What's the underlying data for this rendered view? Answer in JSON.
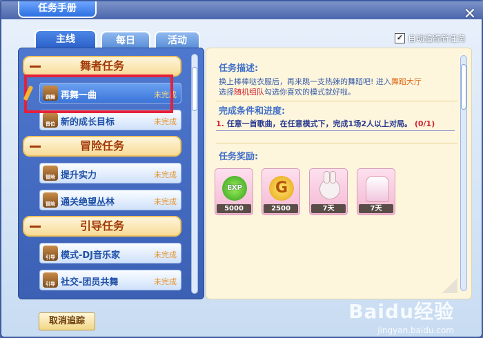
{
  "window": {
    "title": "任务手册",
    "close_glyph": "✕"
  },
  "tabs": [
    {
      "label": "主线",
      "active": true
    },
    {
      "label": "每日",
      "active": false
    },
    {
      "label": "活动",
      "active": false
    }
  ],
  "auto_track": {
    "label": "自动追踪新任务",
    "checked": true
  },
  "categories": [
    {
      "label": "舞者任务",
      "items": [
        {
          "icon_text": "跳舞",
          "name": "再舞一曲",
          "status": "未完成",
          "selected": true
        },
        {
          "icon_text": "晋位",
          "name": "新的成长目标",
          "status": "未完成",
          "selected": false
        }
      ]
    },
    {
      "label": "冒险任务",
      "items": [
        {
          "icon_text": "冒险",
          "name": "提升实力",
          "status": "未完成",
          "selected": false
        },
        {
          "icon_text": "冒险",
          "name": "通关绝望丛林",
          "status": "未完成",
          "selected": false
        }
      ]
    },
    {
      "label": "引导任务",
      "items": [
        {
          "icon_text": "引导",
          "name": "模式-DJ音乐家",
          "status": "未完成",
          "selected": false
        },
        {
          "icon_text": "引导",
          "name": "社交-团员共舞",
          "status": "未完成",
          "selected": false
        }
      ]
    }
  ],
  "detail": {
    "desc_heading": "任务描述:",
    "desc_part1": "换上棒棒哒衣服后，再来跳一支热辣的舞蹈吧! 进入",
    "desc_hl1": "舞蹈大厅",
    "desc_part2": "选择",
    "desc_hl2": "随机组队",
    "desc_part3": "勾选你喜欢的模式就好啦。",
    "cond_heading": "完成条件和进度:",
    "cond_num": "1.",
    "cond_text": "任意一首歌曲，在任意模式下，完成1场2人以上对局。",
    "cond_progress": "(0/1)",
    "reward_heading": "任务奖励:",
    "rewards": [
      {
        "icon": "exp-icon",
        "icon_text": "EXP",
        "qty": "5000"
      },
      {
        "icon": "gold-coin-icon",
        "icon_text": "G",
        "qty": "2500"
      },
      {
        "icon": "bunny-headwear-icon",
        "icon_text": "",
        "qty": "7天"
      },
      {
        "icon": "outfit-icon",
        "icon_text": "",
        "qty": "7天"
      }
    ]
  },
  "footer": {
    "cancel_label": "取消追踪"
  },
  "watermark": {
    "brand": "Baidu经验",
    "url": "jingyan.baidu.com"
  }
}
